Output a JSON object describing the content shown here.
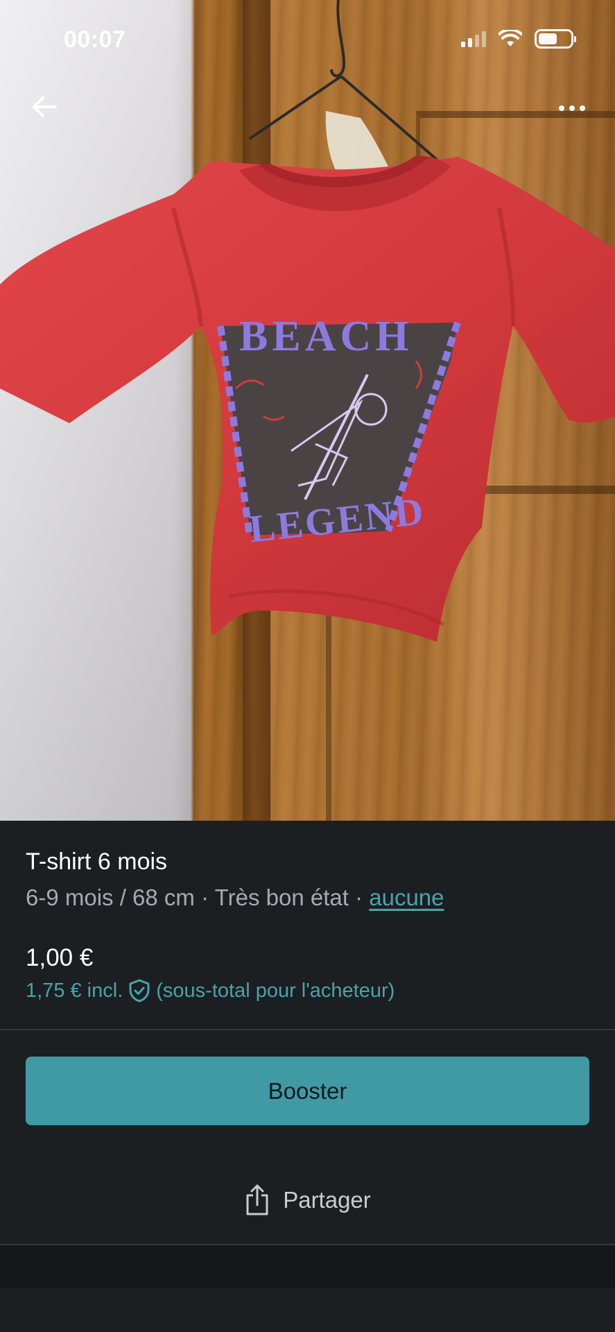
{
  "status_bar": {
    "time": "00:07"
  },
  "nav": {
    "back_icon": "arrow-left-icon",
    "more_icon": "more-horizontal-icon"
  },
  "photo": {
    "print_top_text": "BEACH",
    "print_bottom_text": "LEGEND"
  },
  "item": {
    "title": "T-shirt 6 mois",
    "size": "6-9 mois / 68 cm",
    "separator": "·",
    "condition": "Très bon état",
    "brand_link": "aucune",
    "price": "1,00 €",
    "price_incl": "1,75 € incl.",
    "protection_icon": "shield-check-icon",
    "price_note": "(sous-total pour l'acheteur)"
  },
  "actions": {
    "booster_label": "Booster",
    "share_label": "Partager",
    "share_icon": "share-icon"
  },
  "colors": {
    "accent": "#3f9aa4",
    "link": "#4aa3ac",
    "background": "#1b1f22",
    "shirt": "#d63a3c"
  }
}
